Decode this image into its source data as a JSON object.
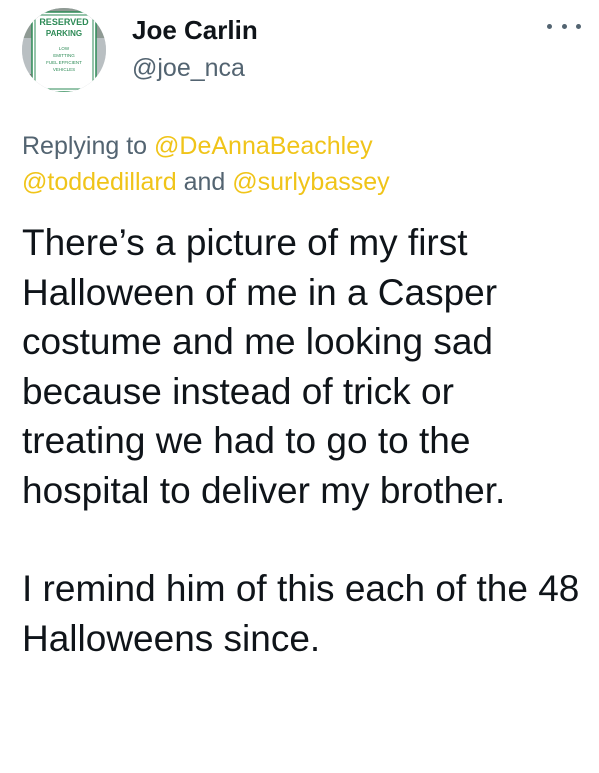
{
  "author": {
    "name": "Joe Carlin",
    "handle": "@joe_nca",
    "avatar_sign": {
      "line1": "RESERVED",
      "line2": "PARKING",
      "line3": "LOW",
      "line4": "EMITTING",
      "line5": "FUEL EFFICIENT",
      "line6": "VEHICLES"
    }
  },
  "more_icon": "more-horizontal-icon",
  "reply": {
    "prefix": "Replying to",
    "mention1": "@DeAnnaBeachley",
    "mention2": "@toddedillard",
    "joiner": "and",
    "mention3": "@surlybassey"
  },
  "tweet": {
    "paragraph1": "There’s a picture of my first Halloween of me in a Casper costume and me looking sad because instead of trick or treating we had to go to the hospital to deliver my brother.",
    "paragraph2": "I remind him of this each of the 48 Halloweens since."
  },
  "colors": {
    "mention": "#f0c419",
    "secondary_text": "#536471",
    "primary_text": "#0f1419",
    "sign_green": "#2e8b57"
  }
}
